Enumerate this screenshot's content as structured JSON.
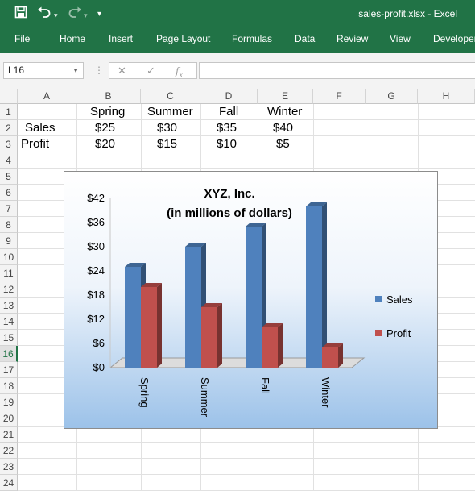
{
  "window": {
    "title": "sales-profit.xlsx - Excel",
    "quick_access": {
      "save_icon": "save-icon",
      "undo_icon": "undo-icon",
      "redo_icon": "redo-icon",
      "customize": "▾"
    }
  },
  "ribbon": {
    "tabs": [
      "File",
      "Home",
      "Insert",
      "Page Layout",
      "Formulas",
      "Data",
      "Review",
      "View",
      "Developer"
    ]
  },
  "formula_bar": {
    "name_box": "L16",
    "formula": ""
  },
  "sheet": {
    "columns": [
      "A",
      "B",
      "C",
      "D",
      "E",
      "F",
      "G",
      "H"
    ],
    "rows": [
      "1",
      "2",
      "3",
      "4",
      "5",
      "6",
      "7",
      "8",
      "9",
      "10",
      "11",
      "12",
      "13",
      "14",
      "15",
      "16",
      "17",
      "18",
      "19",
      "20",
      "21",
      "22",
      "23",
      "24"
    ],
    "selected_row": "16",
    "cells": {
      "B1": "Spring",
      "C1": "Summer",
      "D1": "Fall",
      "E1": "Winter",
      "A2": "Sales",
      "B2": "$25",
      "C2": "$30",
      "D2": "$35",
      "E2": "$40",
      "A3": "Profit",
      "B3": "$20",
      "C3": "$15",
      "D3": "$10",
      "E3": "$5"
    }
  },
  "chart_data": {
    "type": "bar",
    "title": "XYZ, Inc.",
    "subtitle": "(in millions of dollars)",
    "categories": [
      "Spring",
      "Summer",
      "Fall",
      "Winter"
    ],
    "series": [
      {
        "name": "Sales",
        "values": [
          25,
          30,
          35,
          40
        ],
        "color": "#4f81bd"
      },
      {
        "name": "Profit",
        "values": [
          20,
          15,
          10,
          5
        ],
        "color": "#c0504d"
      }
    ],
    "ylim": [
      0,
      42
    ],
    "yticks": [
      "$0",
      "$6",
      "$12",
      "$18",
      "$24",
      "$30",
      "$36",
      "$42"
    ],
    "yvalues": [
      0,
      6,
      12,
      18,
      24,
      30,
      36,
      42
    ],
    "legend": "right",
    "style": "3d-clustered-column"
  }
}
